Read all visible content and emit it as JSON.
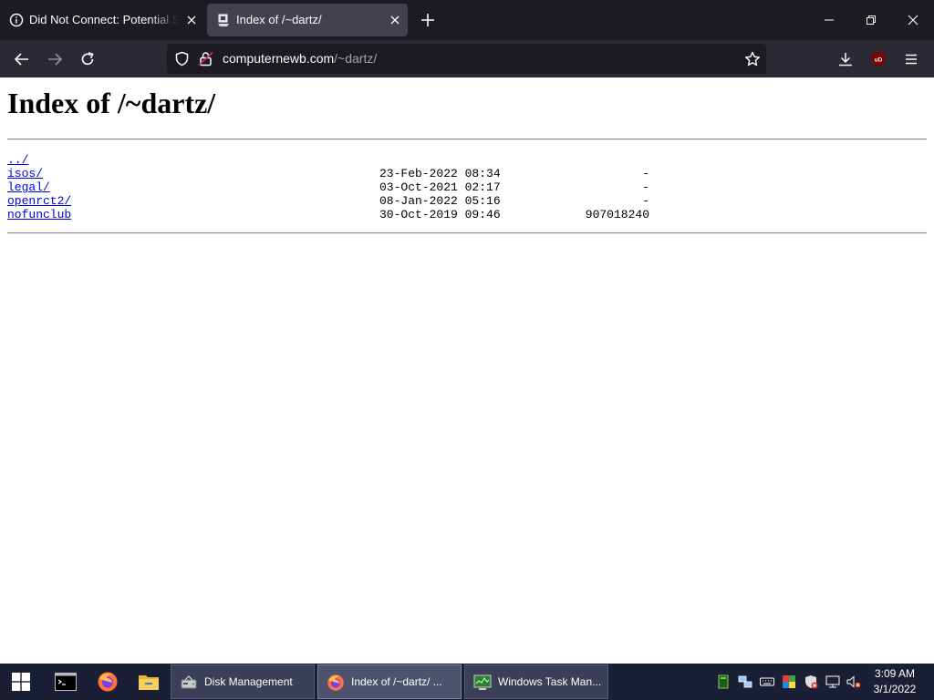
{
  "browser": {
    "tabs": [
      {
        "title": "Did Not Connect: Potential Security Issue",
        "active": false
      },
      {
        "title": "Index of /~dartz/",
        "active": true
      }
    ],
    "url": {
      "host": "computernewb.com",
      "path": "/~dartz/"
    },
    "colors": {
      "tabstrip": "#1c1b22",
      "toolbar": "#2b2a33",
      "active_tab": "#42414d",
      "ublock": "#800000"
    }
  },
  "page": {
    "title": "Index of /~dartz/",
    "entries": [
      {
        "name": "../",
        "date": "",
        "size": ""
      },
      {
        "name": "isos/",
        "date": "23-Feb-2022 08:34",
        "size": "-"
      },
      {
        "name": "legal/",
        "date": "03-Oct-2021 02:17",
        "size": "-"
      },
      {
        "name": "openrct2/",
        "date": "08-Jan-2022 05:16",
        "size": "-"
      },
      {
        "name": "nofunclub",
        "date": "30-Oct-2019 09:46",
        "size": "907018240"
      }
    ]
  },
  "ublock": {
    "label": "uD"
  },
  "taskbar": {
    "tasks": [
      {
        "label": "Disk Management",
        "icon": "disk-management-icon",
        "active": false
      },
      {
        "label": "Index of /~dartz/ ...",
        "icon": "firefox-icon",
        "active": true
      },
      {
        "label": "Windows Task Man...",
        "icon": "task-manager-icon",
        "active": false
      }
    ],
    "clock": {
      "time": "3:09 AM",
      "date": "3/1/2022"
    }
  }
}
